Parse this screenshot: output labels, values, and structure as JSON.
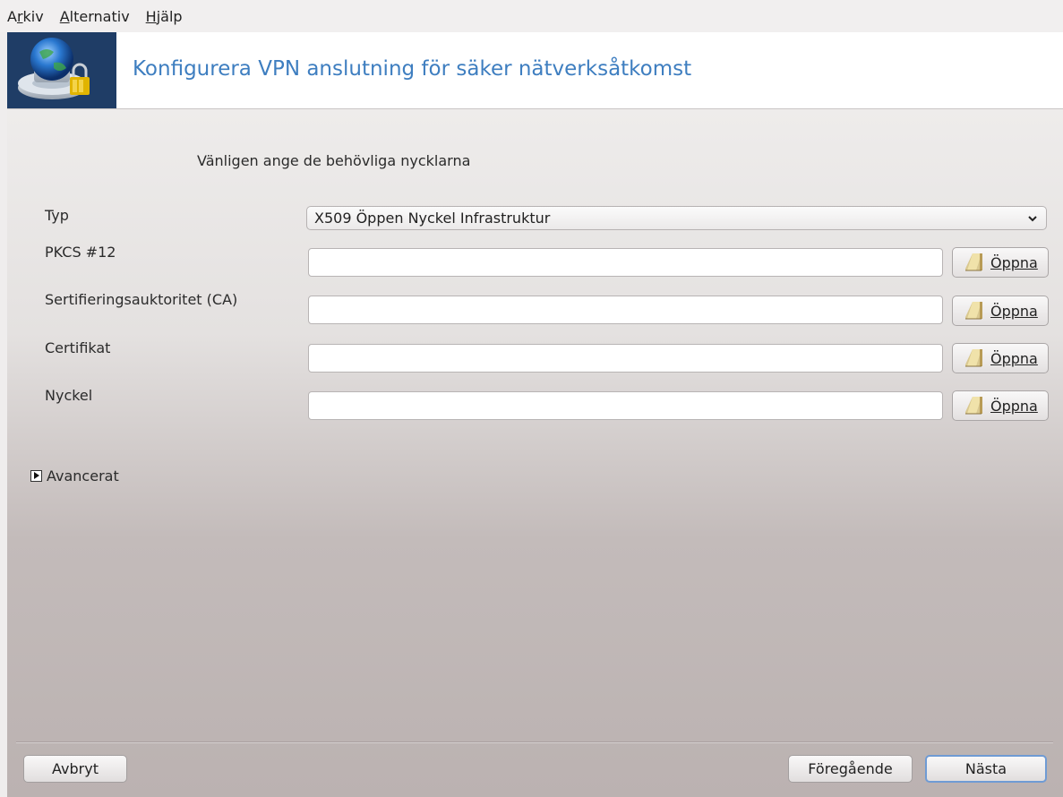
{
  "menu": {
    "items": [
      {
        "label_pre": "A",
        "mnemonic": "r",
        "label_post": "kiv"
      },
      {
        "label_pre": "",
        "mnemonic": "A",
        "label_post": "lternativ"
      },
      {
        "label_pre": "",
        "mnemonic": "H",
        "label_post": "jälp"
      }
    ]
  },
  "header": {
    "title": "Konfigurera VPN anslutning för säker nätverksåtkomst",
    "icon": "vpn-network-lock-icon"
  },
  "form": {
    "instruction": "Vänligen ange de behövliga nycklarna",
    "type_label": "Typ",
    "type_value": "X509 Öppen Nyckel Infrastruktur",
    "fields": [
      {
        "label": "PKCS #12",
        "value": "",
        "button_mnemonic": "Ö",
        "button_rest": "ppna"
      },
      {
        "label": "Sertifieringsauktoritet (CA)",
        "value": "",
        "button_mnemonic": "Ö",
        "button_rest": "ppna"
      },
      {
        "label": "Certifikat",
        "value": "",
        "button_mnemonic": "Ö",
        "button_rest": "ppna"
      },
      {
        "label": "Nyckel",
        "value": "",
        "button_mnemonic": "Ö",
        "button_rest": "ppna"
      }
    ],
    "advanced_label": "Avancerat"
  },
  "footer": {
    "cancel_label": "Avbryt",
    "previous_label": "Föregående",
    "next_label": "Nästa"
  },
  "colors": {
    "accent": "#3e7ec0",
    "default_button_border": "#6f9bd4"
  }
}
